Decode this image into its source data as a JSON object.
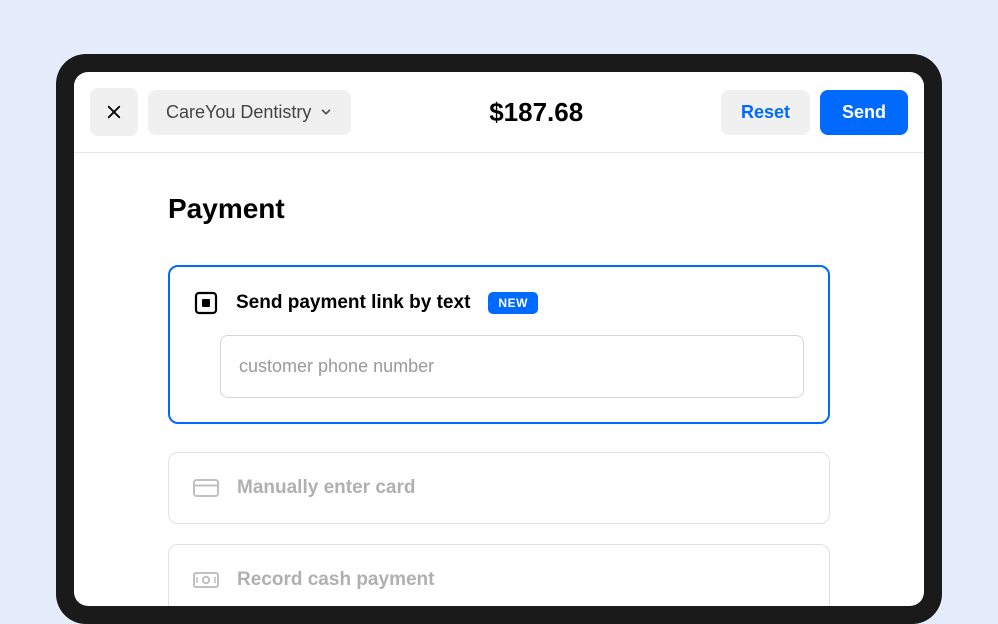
{
  "header": {
    "location": "CareYou Dentistry",
    "amount": "$187.68",
    "reset_label": "Reset",
    "send_label": "Send"
  },
  "page": {
    "title": "Payment"
  },
  "payment_options": {
    "text_link": {
      "title": "Send payment link by text",
      "badge": "NEW",
      "phone_placeholder": "customer phone number"
    },
    "manual_card": {
      "title": "Manually enter card"
    },
    "cash": {
      "title": "Record cash payment"
    }
  }
}
